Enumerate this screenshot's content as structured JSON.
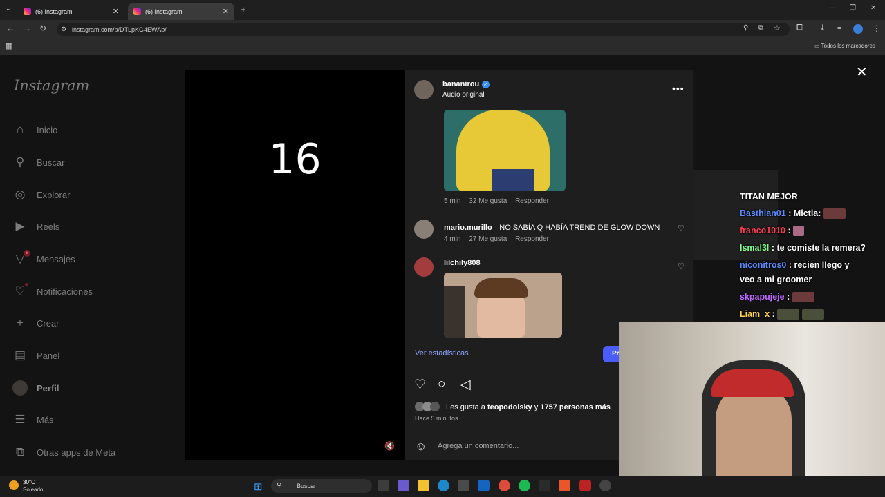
{
  "browser": {
    "tabs": [
      {
        "title": "(6) Instagram",
        "active": false
      },
      {
        "title": "(6) Instagram",
        "active": true
      }
    ],
    "url": "instagram.com/p/DTLpKG4EWAb/",
    "bookmarks_label": "Todos los marcadores"
  },
  "sidebar": {
    "logo": "Instagram",
    "items": [
      {
        "label": "Inicio",
        "icon": "home-icon"
      },
      {
        "label": "Buscar",
        "icon": "search-icon"
      },
      {
        "label": "Explorar",
        "icon": "compass-icon"
      },
      {
        "label": "Reels",
        "icon": "reels-icon"
      },
      {
        "label": "Mensajes",
        "icon": "messenger-icon",
        "badge": "6"
      },
      {
        "label": "Notificaciones",
        "icon": "heart-icon"
      },
      {
        "label": "Crear",
        "icon": "plus-icon"
      },
      {
        "label": "Panel",
        "icon": "chart-icon"
      },
      {
        "label": "Perfil",
        "icon": "avatar"
      },
      {
        "label": "Más",
        "icon": "menu-icon"
      },
      {
        "label": "Otras apps de Meta",
        "icon": "meta-apps-icon"
      }
    ]
  },
  "video": {
    "overlay_text": "16"
  },
  "post": {
    "author": "bananirou",
    "subtitle": "Audio original",
    "comments": [
      {
        "time": "5 min",
        "likes": "32 Me gusta",
        "reply": "Responder"
      },
      {
        "user": "mario.murillo_",
        "text": "NO SABÍA Q HABÍA TREND DE GLOW DOWN",
        "time": "4 min",
        "likes": "27 Me gusta",
        "reply": "Responder"
      },
      {
        "user": "lilchily808"
      }
    ],
    "stats_link": "Ver estadísticas",
    "promote_button": "Pr",
    "likes_prefix": "Les gusta a ",
    "likes_user": "teopodolsky",
    "likes_mid": " y ",
    "likes_count": "1757 personas más",
    "posted_ago": "Hace 5 minutos",
    "comment_placeholder": "Agrega un comentario..."
  },
  "chat": {
    "header": "TITAN MEJOR",
    "lines": [
      {
        "user": "Basthian01",
        "color": "#5b8dff",
        "text": ": Mictia:"
      },
      {
        "user": "franco1010",
        "color": "#ff3c55",
        "text": ":"
      },
      {
        "user": "Ismal3l",
        "color": "#7dff8a",
        "text": ": te comiste la remera?"
      },
      {
        "user": "niconitros0",
        "color": "#5b8dff",
        "text": ": recien llego y"
      },
      {
        "user": "",
        "color": "#ffffff",
        "text": "veo a mi groomer"
      },
      {
        "user": "skpapujeje",
        "color": "#c06bff",
        "text": ":"
      },
      {
        "user": "Liam_x",
        "color": "#ffd84a",
        "text": ":"
      }
    ]
  },
  "taskbar": {
    "temp": "30°C",
    "weather": "Soleado",
    "search": "Buscar"
  }
}
